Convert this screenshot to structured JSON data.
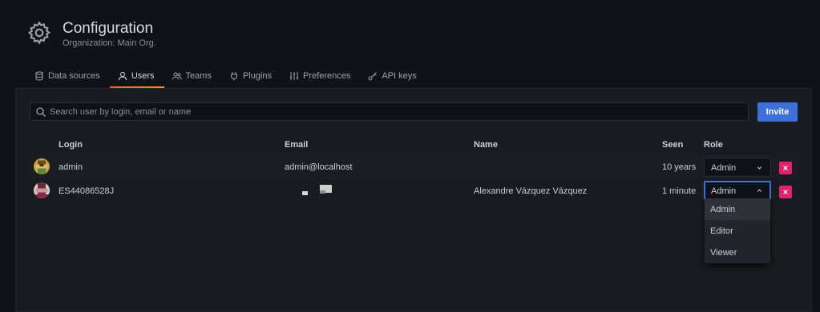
{
  "header": {
    "title": "Configuration",
    "subtitle": "Organization: Main Org.",
    "icon": "gear-icon"
  },
  "tabs": [
    {
      "label": "Data sources",
      "icon": "database-icon",
      "active": false
    },
    {
      "label": "Users",
      "icon": "user-icon",
      "active": true
    },
    {
      "label": "Teams",
      "icon": "users-icon",
      "active": false
    },
    {
      "label": "Plugins",
      "icon": "plug-icon",
      "active": false
    },
    {
      "label": "Preferences",
      "icon": "sliders-icon",
      "active": false
    },
    {
      "label": "API keys",
      "icon": "key-icon",
      "active": false
    }
  ],
  "search": {
    "placeholder": "Search user by login, email or name",
    "value": ""
  },
  "invite_label": "Invite",
  "table": {
    "headers": {
      "login": "Login",
      "email": "Email",
      "name": "Name",
      "seen": "Seen",
      "role": "Role"
    },
    "rows": [
      {
        "login": "admin",
        "email": "admin@localhost",
        "name": "",
        "seen": "10 years",
        "role": "Admin"
      },
      {
        "login": "ES44086528J",
        "email": "",
        "name": "Alexandre Vázquez Vázquez",
        "seen": "1 minute",
        "role": "Admin"
      }
    ]
  },
  "role_options": [
    "Admin",
    "Editor",
    "Viewer"
  ],
  "colors": {
    "accent": "#3d71d9",
    "danger": "#e0226e",
    "tab_underline": "#f55f3e"
  }
}
